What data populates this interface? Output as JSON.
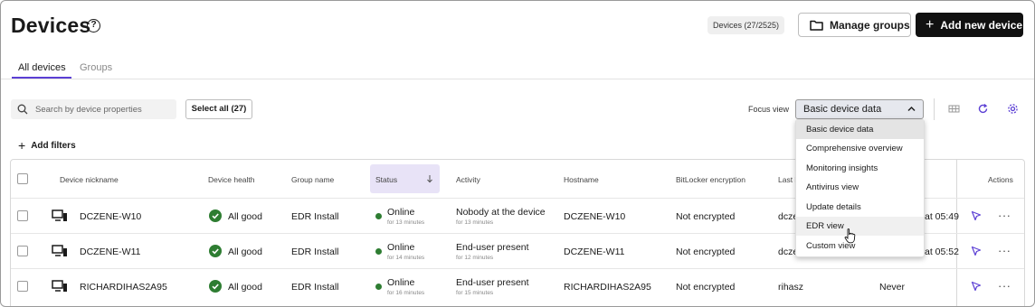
{
  "header": {
    "title": "Devices",
    "help_icon": "?",
    "device_count": "Devices (27/2525)",
    "manage_groups_label": "Manage groups",
    "add_device_label": "Add new device"
  },
  "tabs": [
    {
      "label": "All devices",
      "active": true
    },
    {
      "label": "Groups",
      "active": false
    }
  ],
  "toolbar": {
    "search_placeholder": "Search by device properties",
    "select_all_label": "Select all (27)",
    "focus_view_label": "Focus view",
    "focus_view_value": "Basic device data",
    "add_filters_label": "Add filters",
    "icons": [
      "columns-icon",
      "refresh-icon",
      "settings-icon"
    ]
  },
  "focus_view_options": [
    "Basic device data",
    "Comprehensive overview",
    "Monitoring insights",
    "Antivirus view",
    "Update details",
    "EDR view",
    "Custom view"
  ],
  "table": {
    "columns": [
      "Device nickname",
      "Device health",
      "Group name",
      "Status",
      "Activity",
      "Hostname",
      "BitLocker encryption",
      "Last l",
      "Actions"
    ],
    "rows": [
      {
        "nickname": "DCZENE-W10",
        "health": "All good",
        "group": "EDR Install",
        "status": "Online",
        "status_sub": "for 13 minutes",
        "activity": "Nobody at the device",
        "activity_sub": "for 13 minutes",
        "hostname": "DCZENE-W10",
        "bitlocker": "Not encrypted",
        "last_user": "dcze",
        "last_seen": "at 05:49"
      },
      {
        "nickname": "DCZENE-W11",
        "health": "All good",
        "group": "EDR Install",
        "status": "Online",
        "status_sub": "for 14 minutes",
        "activity": "End-user present",
        "activity_sub": "for 12 minutes",
        "hostname": "DCZENE-W11",
        "bitlocker": "Not encrypted",
        "last_user": "dcze",
        "last_seen": "at 05:52"
      },
      {
        "nickname": "RICHARDIHAS2A95",
        "health": "All good",
        "group": "EDR Install",
        "status": "Online",
        "status_sub": "for 16 minutes",
        "activity": "End-user present",
        "activity_sub": "for 15 minutes",
        "hostname": "RICHARDIHAS2A95",
        "bitlocker": "Not encrypted",
        "last_user": "rihasz",
        "last_seen": "Never"
      }
    ]
  },
  "colors": {
    "accent": "#5b3fd4",
    "status_green": "#2e7d32",
    "primary_button": "#111111"
  }
}
